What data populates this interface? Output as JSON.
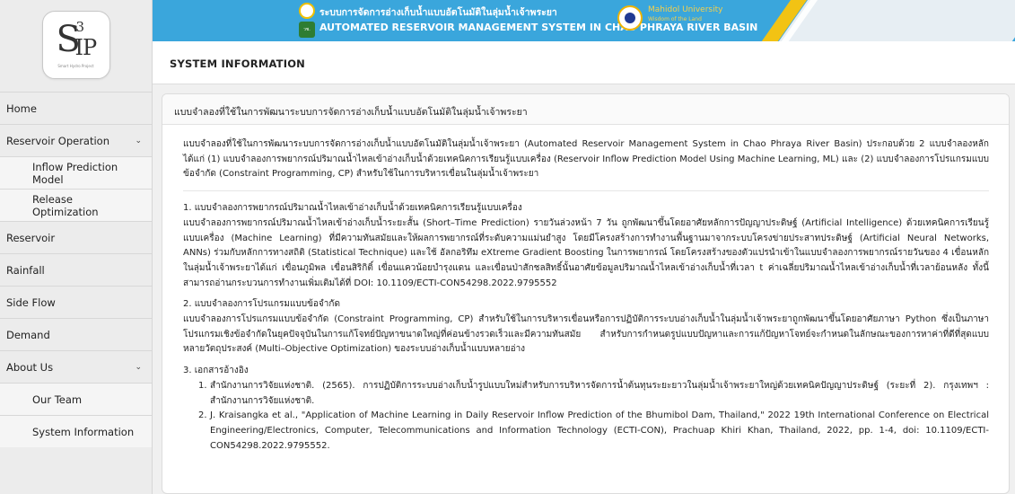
{
  "sidebar": {
    "logo": {
      "main": "S",
      "superscript": "3",
      "rest": "IP",
      "tagline": "Smart Hydro Project"
    },
    "items": [
      {
        "label": "Home",
        "sub": false,
        "chevron": false
      },
      {
        "label": "Reservoir Operation",
        "sub": false,
        "chevron": true
      },
      {
        "label": "Inflow Prediction Model",
        "sub": true,
        "chevron": false
      },
      {
        "label": "Release Optimization",
        "sub": true,
        "chevron": false
      },
      {
        "label": "Reservoir",
        "sub": false,
        "chevron": false
      },
      {
        "label": "Rainfall",
        "sub": false,
        "chevron": false
      },
      {
        "label": "Side Flow",
        "sub": false,
        "chevron": false
      },
      {
        "label": "Demand",
        "sub": false,
        "chevron": false
      },
      {
        "label": "About Us",
        "sub": false,
        "chevron": true
      },
      {
        "label": "Our Team",
        "sub": true,
        "chevron": false
      },
      {
        "label": "System Information",
        "sub": true,
        "chevron": false
      }
    ],
    "chevron_glyph": "⌄"
  },
  "header": {
    "title_th": "ระบบการจัดการอ่างเก็บน้ำแบบอัตโนมัติในลุ่มน้ำเจ้าพระยา",
    "title_en": "AUTOMATED RESERVOIR MANAGEMENT SYSTEM IN CHAO PHRAYA RIVER BASIN",
    "seal_text": "วช.",
    "university": "Mahidol University",
    "university_sub": "Wisdom of the Land",
    "colors": {
      "bar": "#3aa6dc",
      "accent": "#f2c314"
    }
  },
  "page": {
    "title": "SYSTEM INFORMATION"
  },
  "card": {
    "header": "แบบจำลองที่ใช้ในการพัฒนาระบบการจัดการอ่างเก็บน้ำแบบอัตโนมัติในลุ่มน้ำเจ้าพระยา",
    "intro": "แบบจำลองที่ใช้ในการพัฒนาระบบการจัดการอ่างเก็บน้ำแบบอัตโนมัติในลุ่มน้ำเจ้าพระยา (Automated Reservoir Management System in Chao Phraya River Basin) ประกอบด้วย 2 แบบจำลองหลัก ได้แก่ (1) แบบจำลองการพยากรณ์ปริมาณน้ำไหลเข้าอ่างเก็บน้ำด้วยเทคนิคการเรียนรู้แบบเครื่อง (Reservoir Inflow Prediction Model Using Machine Learning, ML) และ (2) แบบจำลองการโปรแกรมแบบข้อจำกัด (Constraint Programming, CP) สำหรับใช้ในการบริหารเขื่อนในลุ่มน้ำเจ้าพระยา",
    "section1_title": "1. แบบจำลองการพยากรณ์ปริมาณน้ำไหลเข้าอ่างเก็บน้ำด้วยเทคนิคการเรียนรู้แบบเครื่อง",
    "section1_body": "แบบจำลองการพยากรณ์ปริมาณน้ำไหลเข้าอ่างเก็บน้ำระยะสั้น (Short–Time Prediction) รายวันล่วงหน้า 7 วัน ถูกพัฒนาขึ้นโดยอาศัยหลักการปัญญาประดิษฐ์ (Artificial Intelligence) ด้วยเทคนิคการเรียนรู้แบบเครื่อง (Machine Learning) ที่มีความทันสมัยและให้ผลการพยากรณ์ที่ระดับความแม่นยำสูง โดยมีโครงสร้างการทำงานพื้นฐานมาจากระบบโครงข่ายประสาทประดิษฐ์ (Artificial Neural Networks, ANNs) ร่วมกับหลักการทางสถิติ (Statistical Technique) และใช้ อัลกอริทึม eXtreme Gradient Boosting ในการพยากรณ์ โดยโครงสร้างของตัวแปรนำเข้าในแบบจำลองการพยากรณ์รายวันของ 4 เขื่อนหลักในลุ่มน้ำเจ้าพระยาได้แก่ เขื่อนภูมิพล เขื่อนสิริกิติ์ เขื่อนแควน้อยบำรุงแดน และเขื่อนป่าสักชลสิทธิ์นั้นอาศัยข้อมูลปริมาณน้ำไหลเข้าอ่างเก็บน้ำที่เวลา t ค่าเฉลี่ยปริมาณน้ำไหลเข้าอ่างเก็บน้ำที่เวลาย้อนหลัง ทั้งนี้สามารถอ่านกระบวนการทำงานเพิ่มเติมได้ที่ DOI: 10.1109/ECTI-CON54298.2022.9795552",
    "section2_title": "2. แบบจำลองการโปรแกรมแบบข้อจำกัด",
    "section2_body": "แบบจำลองการโปรแกรมแบบข้อจำกัด (Constraint Programming, CP) สำหรับใช้ในการบริหารเขื่อนหรือการปฏิบัติการระบบอ่างเก็บน้ำในลุ่มน้ำเจ้าพระยาถูกพัฒนาขึ้นโดยอาศัยภาษา Python ซึ่งเป็นภาษาโปรแกรมเชิงข้อจำกัดในยุคปัจจุบันในการแก้โจทย์ปัญหาขนาดใหญ่ที่ค่อนข้างรวดเร็วและมีความทันสมัย สำหรับการกำหนดรูปแบบปัญหาและการแก้ปัญหาโจทย์จะกำหนดในลักษณะของการหาค่าที่ดีที่สุดแบบหลายวัตถุประสงค์ (Multi–Objective Optimization) ของระบบอ่างเก็บน้ำแบบหลายอ่าง",
    "section3_title": "3. เอกสารอ้างอิง",
    "references": [
      {
        "num": "1.",
        "text": "สำนักงานการวิจัยแห่งชาติ. (2565). การปฏิบัติการระบบอ่างเก็บน้ำรูปแบบใหม่สำหรับการบริหารจัดการน้ำต้นทุนระยะยาวในลุ่มน้ำเจ้าพระยาใหญ่ด้วยเทคนิคปัญญาประดิษฐ์ (ระยะที่ 2). กรุงเทพฯ : สำนักงานการวิจัยแห่งชาติ."
      },
      {
        "num": "2.",
        "text": "J. Kraisangka et al., \"Application of Machine Learning in Daily Reservoir Inflow Prediction of the Bhumibol Dam, Thailand,\" 2022 19th International Conference on Electrical Engineering/Electronics, Computer, Telecommunications and Information Technology (ECTI-CON), Prachuap Khiri Khan, Thailand, 2022, pp. 1-4, doi: 10.1109/ECTI-CON54298.2022.9795552."
      }
    ]
  }
}
